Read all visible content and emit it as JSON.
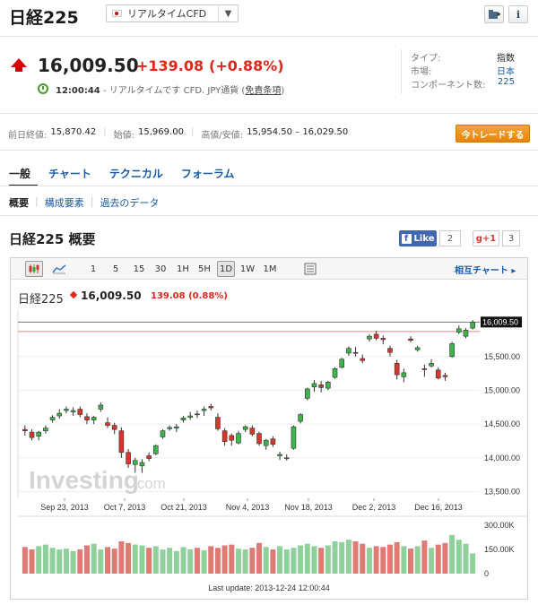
{
  "header": {
    "title": "日経225",
    "market_select": "リアルタイムCFD",
    "icons": [
      "folder-add-icon",
      "info-icon"
    ]
  },
  "quote": {
    "price": "16,009.50",
    "change": "+139.08",
    "change_pct": "(+0.88%)",
    "time": "12:00:44",
    "time_text": " - リアルタイムです CFD. JPY通貨 (",
    "disclaimer": "免責条項",
    "time_close": ")"
  },
  "meta": {
    "type_label": "タイプ:",
    "type_value": "指数",
    "market_label": "市場:",
    "market_value": "日本",
    "components_label": "コンポーネント数:",
    "components_value": "225"
  },
  "stats": {
    "prev_close_label": "前日終値:",
    "prev_close": "15,870.42",
    "open_label": "始値:",
    "open": "15,969.00",
    "range_label": "高値/安値:",
    "range": "15,954.50 – 16,029.50"
  },
  "trade_button": "今トレードする",
  "tabs": [
    "一般",
    "チャート",
    "テクニカル",
    "フォーラム"
  ],
  "subtabs": [
    "概要",
    "構成要素",
    "過去のデータ"
  ],
  "section_title": "日経225 概要",
  "social": {
    "fb_label": "Like",
    "fb_count": "2",
    "gplus_label": "g+1",
    "gplus_count": "3"
  },
  "toolbar": {
    "timeframes": [
      "1",
      "5",
      "15",
      "30",
      "1H",
      "5H",
      "1D",
      "1W",
      "1M"
    ],
    "active_timeframe": "1D",
    "compare_label": "相互チャート ▸"
  },
  "chart_header": {
    "name": "日経225",
    "price": "16,009.50",
    "change": "139.08 (0.88%)"
  },
  "colors": {
    "up": "#3cb64a",
    "down": "#d8352c",
    "vol_up": "#8fd19a",
    "vol_down": "#e07a74",
    "accent": "#e0271b",
    "link": "#1a5aa6"
  },
  "chart_data": {
    "type": "candlestick",
    "x_labels": [
      "Sep 23, 2013",
      "Oct 7, 2013",
      "Oct 21, 2013",
      "Nov 4, 2013",
      "Nov 18, 2013",
      "Dec 2, 2013",
      "Dec 16, 2013"
    ],
    "y_ticks": [
      "15,500.00",
      "15,000.00",
      "14,500.00",
      "14,000.00",
      "13,500.00"
    ],
    "ylim": [
      13400,
      16200
    ],
    "last_price_label": "16,009.50",
    "vol_ticks": [
      "300.00K",
      "150.00K",
      "0"
    ],
    "watermark": "Investing.com",
    "footer": "Last update: 2013-12-24 12:00:44",
    "candles": [
      [
        14420,
        14480,
        14330,
        14400
      ],
      [
        14380,
        14420,
        14260,
        14300
      ],
      [
        14320,
        14400,
        14260,
        14380
      ],
      [
        14400,
        14480,
        14360,
        14440
      ],
      [
        14560,
        14630,
        14520,
        14600
      ],
      [
        14620,
        14720,
        14580,
        14660
      ],
      [
        14700,
        14760,
        14660,
        14720
      ],
      [
        14680,
        14750,
        14620,
        14700
      ],
      [
        14720,
        14760,
        14600,
        14640
      ],
      [
        14610,
        14660,
        14500,
        14560
      ],
      [
        14560,
        14620,
        14500,
        14600
      ],
      [
        14720,
        14820,
        14680,
        14780
      ],
      [
        14520,
        14600,
        14440,
        14480
      ],
      [
        14480,
        14520,
        14350,
        14420
      ],
      [
        14400,
        14450,
        14000,
        14080
      ],
      [
        14080,
        14130,
        13850,
        13910
      ],
      [
        13900,
        14000,
        13780,
        13960
      ],
      [
        13880,
        13980,
        13780,
        13930
      ],
      [
        14030,
        14080,
        13950,
        13990
      ],
      [
        14060,
        14200,
        14040,
        14180
      ],
      [
        14310,
        14420,
        14280,
        14400
      ],
      [
        14430,
        14480,
        14400,
        14450
      ],
      [
        14440,
        14500,
        14380,
        14460
      ],
      [
        14560,
        14620,
        14520,
        14590
      ],
      [
        14600,
        14680,
        14560,
        14620
      ],
      [
        14650,
        14700,
        14590,
        14640
      ],
      [
        14700,
        14760,
        14620,
        14720
      ],
      [
        14760,
        14800,
        14700,
        14740
      ],
      [
        14600,
        14660,
        14400,
        14430
      ],
      [
        14400,
        14440,
        14180,
        14240
      ],
      [
        14330,
        14360,
        14180,
        14260
      ],
      [
        14220,
        14400,
        14200,
        14360
      ],
      [
        14420,
        14480,
        14380,
        14460
      ],
      [
        14440,
        14480,
        14320,
        14350
      ],
      [
        14360,
        14390,
        14180,
        14210
      ],
      [
        14180,
        14280,
        14120,
        14260
      ],
      [
        14280,
        14320,
        14160,
        14200
      ],
      [
        14030,
        14090,
        13970,
        14050
      ],
      [
        14000,
        14050,
        13960,
        14000
      ],
      [
        14140,
        14480,
        14120,
        14460
      ],
      [
        14540,
        14660,
        14510,
        14640
      ],
      [
        14880,
        15040,
        14850,
        15020
      ],
      [
        15050,
        15150,
        14980,
        15100
      ],
      [
        15080,
        15140,
        14970,
        15040
      ],
      [
        15030,
        15140,
        15000,
        15120
      ],
      [
        15190,
        15340,
        15170,
        15320
      ],
      [
        15340,
        15480,
        15320,
        15460
      ],
      [
        15550,
        15650,
        15510,
        15620
      ],
      [
        15560,
        15640,
        15500,
        15550
      ],
      [
        15470,
        15530,
        15400,
        15440
      ],
      [
        15760,
        15830,
        15720,
        15800
      ],
      [
        15830,
        15880,
        15740,
        15770
      ],
      [
        15770,
        15810,
        15680,
        15750
      ],
      [
        15620,
        15660,
        15500,
        15560
      ],
      [
        15400,
        15450,
        15160,
        15230
      ],
      [
        15200,
        15320,
        15120,
        15260
      ],
      [
        15760,
        15800,
        15710,
        15740
      ],
      [
        15600,
        15660,
        15570,
        15630
      ],
      [
        15320,
        15380,
        15200,
        15310
      ],
      [
        15360,
        15460,
        15340,
        15400
      ],
      [
        15300,
        15340,
        15160,
        15180
      ],
      [
        15220,
        15260,
        15140,
        15200
      ],
      [
        15500,
        15720,
        15480,
        15690
      ],
      [
        15860,
        15960,
        15830,
        15910
      ],
      [
        15800,
        15920,
        15770,
        15890
      ],
      [
        15920,
        16040,
        15900,
        16010
      ]
    ],
    "volumes": [
      165,
      150,
      170,
      180,
      160,
      150,
      155,
      140,
      150,
      175,
      185,
      150,
      165,
      155,
      200,
      190,
      180,
      175,
      160,
      170,
      150,
      160,
      140,
      165,
      150,
      160,
      145,
      170,
      160,
      175,
      180,
      155,
      150,
      160,
      190,
      165,
      150,
      170,
      150,
      160,
      175,
      185,
      170,
      160,
      175,
      200,
      195,
      210,
      200,
      185,
      160,
      170,
      165,
      180,
      195,
      170,
      155,
      170,
      205,
      160,
      180,
      190,
      240,
      210,
      185,
      125
    ]
  }
}
